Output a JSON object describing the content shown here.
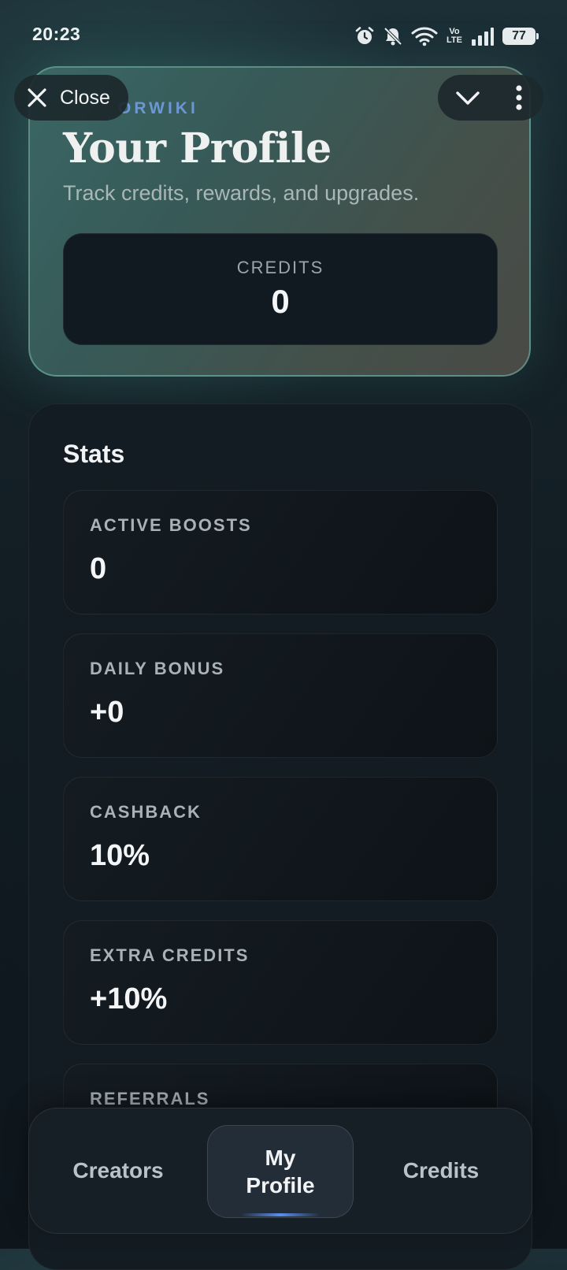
{
  "status_bar": {
    "time": "20:23",
    "network_label": "Vo LTE",
    "battery_level": "77"
  },
  "top_bar": {
    "close_label": "Close",
    "icons": [
      "close-icon",
      "chevron-down-icon",
      "more-vertical-icon"
    ]
  },
  "hero": {
    "brand_label": "ORWIKI",
    "title": "Your Profile",
    "subtitle": "Track credits, rewards, and upgrades.",
    "credits_label": "CREDITS",
    "credits_value": "0"
  },
  "stats": {
    "title": "Stats",
    "items": [
      {
        "label": "ACTIVE BOOSTS",
        "value": "0"
      },
      {
        "label": "DAILY BONUS",
        "value": "+0"
      },
      {
        "label": "CASHBACK",
        "value": "10%"
      },
      {
        "label": "EXTRA CREDITS",
        "value": "+10%"
      },
      {
        "label": "REFERRALS",
        "value": ""
      }
    ]
  },
  "bottom_nav": {
    "items": [
      {
        "label": "Creators",
        "active": false
      },
      {
        "label": "My Profile",
        "active": true
      },
      {
        "label": "Credits",
        "active": false
      }
    ]
  },
  "colors": {
    "accent": "#5b8ff0",
    "brand_label": "#6c97d4",
    "hero_border": "#78beaf"
  }
}
